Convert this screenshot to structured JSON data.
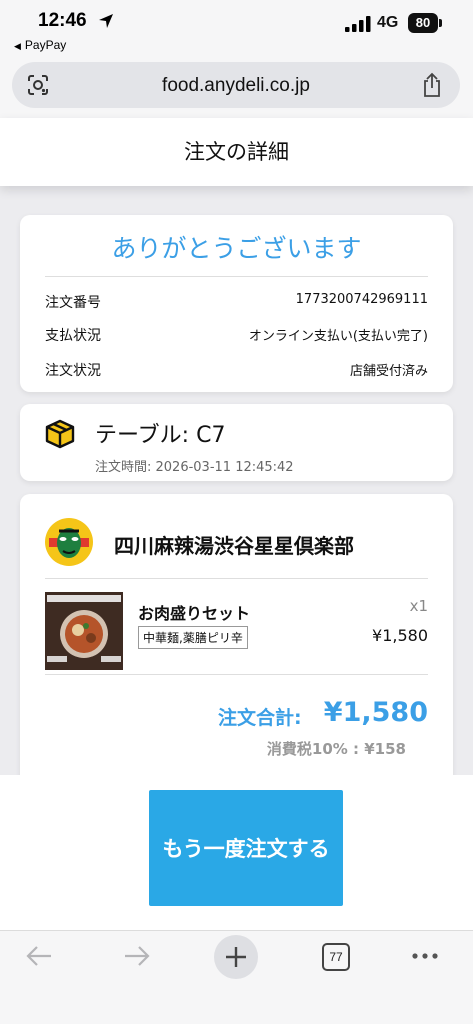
{
  "status": {
    "time": "12:46",
    "back_app": "PayPay",
    "network": "4G",
    "battery": "80"
  },
  "browser": {
    "url": "food.anydeli.co.jp",
    "tabs_count": "77"
  },
  "page": {
    "title": "注文の詳細"
  },
  "thanks": {
    "title": "ありがとうございます",
    "rows": [
      {
        "label": "注文番号",
        "value": "1773200742969111"
      },
      {
        "label": "支払状況",
        "value": "オンライン支払い(支払い完了)"
      },
      {
        "label": "注文状況",
        "value": "店舗受付済み"
      }
    ]
  },
  "table": {
    "label": "テーブル: C7",
    "order_time": "注文時間: 2026-03-11 12:45:42"
  },
  "store": {
    "name": "四川麻辣湯渋谷星星倶楽部",
    "item": {
      "name": "お肉盛りセット",
      "options": "中華麺,薬膳ピリ辛",
      "qty": "x1",
      "price": "¥1,580"
    },
    "total_label": "注文合計:",
    "total_value": "¥1,580",
    "tax": "消費税10% : ¥158"
  },
  "actions": {
    "reorder_label": "もう一度注文する"
  },
  "colors": {
    "accent": "#3b9fe6",
    "button": "#2aa8e6"
  }
}
